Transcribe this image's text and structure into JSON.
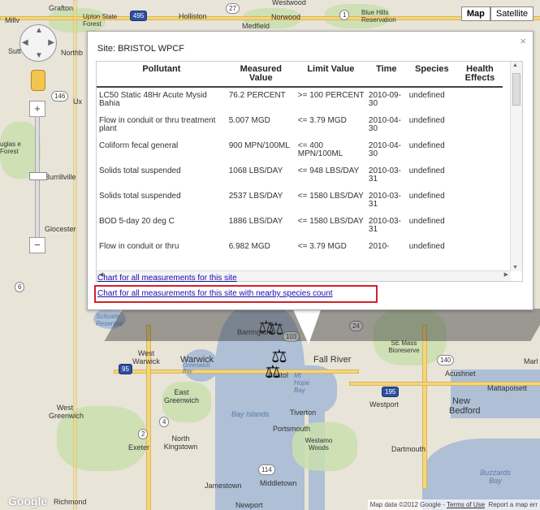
{
  "map": {
    "places": [
      {
        "t": "Grafton"
      },
      {
        "t": "Upton State Forest"
      },
      {
        "t": "Holliston"
      },
      {
        "t": "Medfield"
      },
      {
        "t": "Norwood"
      },
      {
        "t": "Millv"
      },
      {
        "t": "Sutt"
      },
      {
        "t": "Northb"
      },
      {
        "t": "Ux"
      },
      {
        "t": "Burrillville"
      },
      {
        "t": "Glocester"
      },
      {
        "t": "West Warwick"
      },
      {
        "t": "Warwick"
      },
      {
        "t": "East Greenwich"
      },
      {
        "t": "West Greenwich"
      },
      {
        "t": "North Kingstown"
      },
      {
        "t": "Exeter"
      },
      {
        "t": "Barrington"
      },
      {
        "t": "Bristol"
      },
      {
        "t": "Fall River"
      },
      {
        "t": "SE Mass Bioreserve"
      },
      {
        "t": "Acushnet"
      },
      {
        "t": "Mattapoisett"
      },
      {
        "t": "Westport"
      },
      {
        "t": "New Bedford"
      },
      {
        "t": "Tiverton"
      },
      {
        "t": "Portsmouth"
      },
      {
        "t": "Westamo Woods"
      },
      {
        "t": "Dartmouth"
      },
      {
        "t": "Jamestown"
      },
      {
        "t": "Middletown"
      },
      {
        "t": "Newport"
      },
      {
        "t": "Richmond"
      },
      {
        "t": "Bay Islands"
      },
      {
        "t": "Mt Hope Bay"
      },
      {
        "t": "Buzzards Bay"
      },
      {
        "t": "Greenwich Bay"
      },
      {
        "t": "Blue Hills Reservation"
      },
      {
        "t": "Westwood"
      },
      {
        "t": "Marl"
      },
      {
        "t": "Scituate Reservoir"
      },
      {
        "t": "uglas e Forest"
      }
    ],
    "shields": [
      {
        "t": "495",
        "us": true
      },
      {
        "t": "27"
      },
      {
        "t": "1"
      },
      {
        "t": "146"
      },
      {
        "t": "6"
      },
      {
        "t": "95",
        "us": true
      },
      {
        "t": "103"
      },
      {
        "t": "24"
      },
      {
        "t": "140"
      },
      {
        "t": "195",
        "us": true
      },
      {
        "t": "4"
      },
      {
        "t": "2"
      },
      {
        "t": "114"
      }
    ]
  },
  "maptype": {
    "map": "Map",
    "satellite": "Satellite"
  },
  "infowindow": {
    "title": "Site: BRISTOL WPCF",
    "close": "×",
    "headers": [
      "Pollutant",
      "Measured Value",
      "Limit Value",
      "Time",
      "Species",
      "Health Effects"
    ],
    "rows": [
      [
        "LC50 Static 48Hr Acute Mysid Bahia",
        "76.2 PERCENT",
        ">= 100 PERCENT",
        "2010-09-30",
        "undefined"
      ],
      [
        "Flow in conduit or thru treatment plant",
        "5.007 MGD",
        "<= 3.79 MGD",
        "2010-04-30",
        "undefined"
      ],
      [
        "Coliform fecal general",
        "900 MPN/100ML",
        "<= 400 MPN/100ML",
        "2010-04-30",
        "undefined"
      ],
      [
        "Solids total suspended",
        "1068 LBS/DAY",
        "<= 948 LBS/DAY",
        "2010-03-31",
        "undefined"
      ],
      [
        "Solids total suspended",
        "2537 LBS/DAY",
        "<= 1580 LBS/DAY",
        "2010-03-31",
        "undefined"
      ],
      [
        "BOD 5-day 20 deg C",
        "1886 LBS/DAY",
        "<= 1580 LBS/DAY",
        "2010-03-31",
        "undefined"
      ],
      [
        "Flow in conduit or thru",
        "6.982 MGD",
        "<= 3.79 MGD",
        "2010-",
        "undefined"
      ]
    ],
    "links": {
      "chart_all": "Chart for all measurements for this site",
      "chart_species": "Chart for all measurements for this site with nearby species count"
    }
  },
  "footer": {
    "mapdata": "Map data ©2012 Google - ",
    "terms": "Terms of Use",
    "report": "Report a map err"
  },
  "logo": "Google",
  "colors": {
    "highlight": "#d51f2a",
    "link": "#1a0dab",
    "water": "#aebfd6"
  }
}
